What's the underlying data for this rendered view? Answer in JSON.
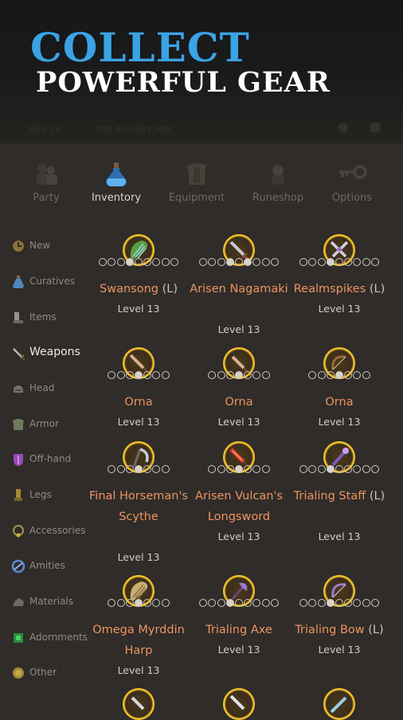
{
  "hero": {
    "title": "COLLECT",
    "subtitle": "POWERFUL GEAR"
  },
  "faded_header": {
    "left_text": "RES 73",
    "middle_text": "999,999,999,999"
  },
  "tabs": [
    {
      "label": "Party",
      "icon": "party-icon"
    },
    {
      "label": "Inventory",
      "icon": "potion-icon",
      "active": true
    },
    {
      "label": "Equipment",
      "icon": "armor-icon"
    },
    {
      "label": "Runeshop",
      "icon": "rune-icon"
    },
    {
      "label": "Options",
      "icon": "key-icon"
    }
  ],
  "sidebar": [
    {
      "label": "New",
      "icon": "clock-icon"
    },
    {
      "label": "Curatives",
      "icon": "potion-icon"
    },
    {
      "label": "Items",
      "icon": "boot-icon"
    },
    {
      "label": "Weapons",
      "icon": "sword-icon",
      "active": true
    },
    {
      "label": "Head",
      "icon": "helmet-icon"
    },
    {
      "label": "Armor",
      "icon": "armor-icon"
    },
    {
      "label": "Off-hand",
      "icon": "shield-icon"
    },
    {
      "label": "Legs",
      "icon": "greaves-icon"
    },
    {
      "label": "Accessories",
      "icon": "necklace-icon"
    },
    {
      "label": "Amities",
      "icon": "amity-icon"
    },
    {
      "label": "Materials",
      "icon": "ore-icon"
    },
    {
      "label": "Adornments",
      "icon": "gem-icon"
    },
    {
      "label": "Other",
      "icon": "coin-icon"
    }
  ],
  "items": [
    {
      "name": "Swansong",
      "tag": "(L)",
      "level": "Level 13",
      "icon": "harp-icon"
    },
    {
      "name": "Arisen Nagamaki",
      "tag": "",
      "level": "Level 13",
      "icon": "sword-icon"
    },
    {
      "name": "Realmspikes",
      "tag": "(L)",
      "level": "Level 13",
      "icon": "crossed-blades-icon"
    },
    {
      "name": "Orna",
      "tag": "",
      "level": "Level 13",
      "icon": "sword-icon"
    },
    {
      "name": "Orna",
      "tag": "",
      "level": "Level 13",
      "icon": "sword-icon"
    },
    {
      "name": "Orna",
      "tag": "",
      "level": "Level 13",
      "icon": "bow-icon"
    },
    {
      "name": "Final Horseman's Scythe",
      "tag": "",
      "level": "Level 13",
      "icon": "scythe-icon"
    },
    {
      "name": "Arisen Vulcan's Longsword",
      "tag": "",
      "level": "Level 13",
      "icon": "fire-sword-icon"
    },
    {
      "name": "Trialing Staff",
      "tag": "(L)",
      "level": "Level 13",
      "icon": "staff-icon"
    },
    {
      "name": "Omega Myrddin Harp",
      "tag": "",
      "level": "Level 13",
      "icon": "harp-icon"
    },
    {
      "name": "Trialing Axe",
      "tag": "",
      "level": "Level 13",
      "icon": "axe-icon"
    },
    {
      "name": "Trialing Bow",
      "tag": "(L)",
      "level": "Level 13",
      "icon": "bow-icon"
    },
    {
      "name": "",
      "tag": "",
      "level": "",
      "icon": "dagger-icon"
    },
    {
      "name": "",
      "tag": "",
      "level": "",
      "icon": "sword-icon"
    },
    {
      "name": "",
      "tag": "",
      "level": "",
      "icon": "spear-icon"
    }
  ],
  "colors": {
    "item_name": "#ee9460",
    "hero_title": "#3aa3e4",
    "glow": "#ffd23a"
  }
}
